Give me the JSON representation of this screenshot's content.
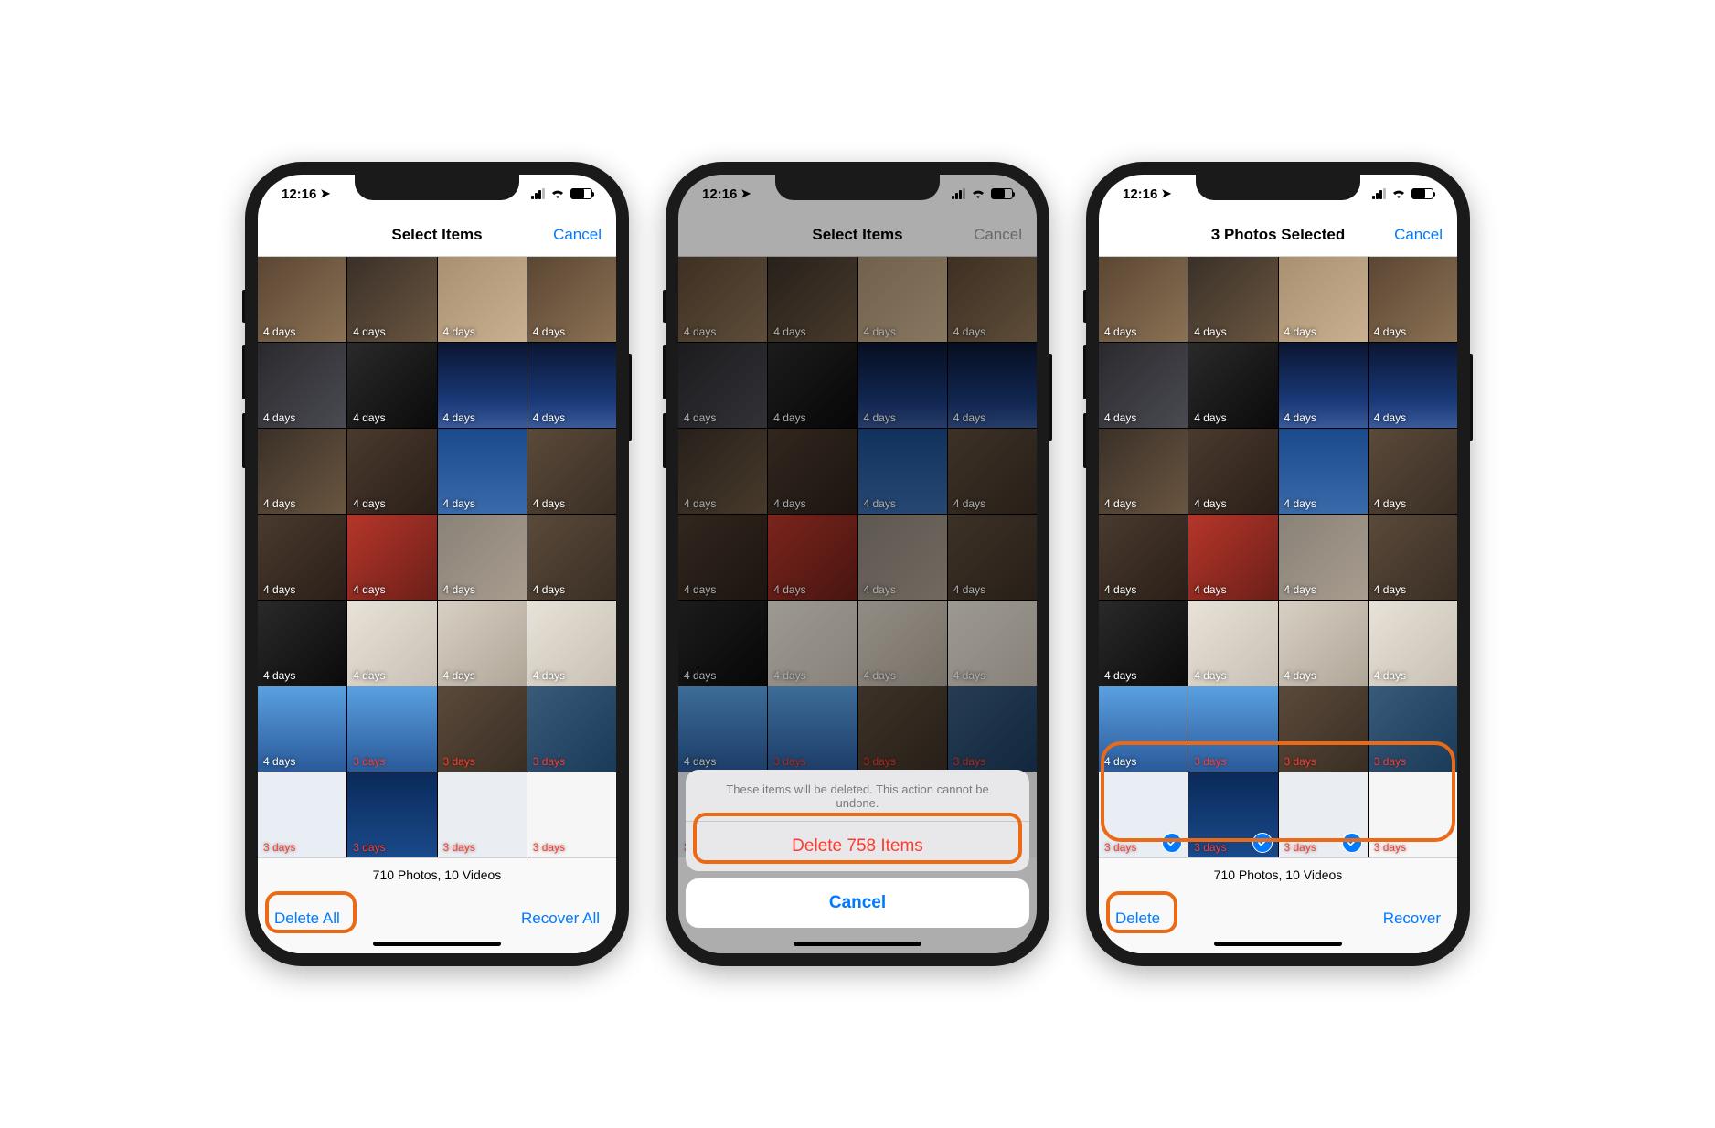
{
  "status": {
    "time": "12:16",
    "nav_glyph": "➤"
  },
  "nav": {
    "title_select": "Select Items",
    "title_selected": "3 Photos Selected",
    "cancel": "Cancel"
  },
  "labels": {
    "d4": "4 days",
    "d3": "3 days"
  },
  "toolbar": {
    "counts": "710 Photos, 10 Videos",
    "delete_all": "Delete All",
    "recover_all": "Recover All",
    "delete": "Delete",
    "recover": "Recover"
  },
  "sheet": {
    "message": "These items will be deleted. This action cannot be undone.",
    "delete_items": "Delete 758 Items",
    "cancel": "Cancel"
  },
  "grid": {
    "rows": [
      [
        {
          "bg": "bg-a",
          "lbl": "d4"
        },
        {
          "bg": "bg-d",
          "lbl": "d4"
        },
        {
          "bg": "bg-e",
          "lbl": "d4"
        },
        {
          "bg": "bg-a",
          "lbl": "d4"
        }
      ],
      [
        {
          "bg": "bg-b",
          "lbl": "d4"
        },
        {
          "bg": "bg-i",
          "lbl": "d4"
        },
        {
          "bg": "bg-c",
          "lbl": "d4"
        },
        {
          "bg": "bg-c",
          "lbl": "d4"
        }
      ],
      [
        {
          "bg": "bg-d",
          "lbl": "d4"
        },
        {
          "bg": "bg-f",
          "lbl": "d4"
        },
        {
          "bg": "bg-k",
          "lbl": "d4"
        },
        {
          "bg": "bg-p",
          "lbl": "d4"
        }
      ],
      [
        {
          "bg": "bg-f",
          "lbl": "d4"
        },
        {
          "bg": "bg-g",
          "lbl": "d4"
        },
        {
          "bg": "bg-h",
          "lbl": "d4"
        },
        {
          "bg": "bg-p",
          "lbl": "d4"
        }
      ],
      [
        {
          "bg": "bg-i",
          "lbl": "d4"
        },
        {
          "bg": "bg-j",
          "lbl": "d4"
        },
        {
          "bg": "bg-l",
          "lbl": "d4"
        },
        {
          "bg": "bg-j",
          "lbl": "d4"
        }
      ],
      [
        {
          "bg": "bg-m",
          "lbl": "d4"
        },
        {
          "bg": "bg-m",
          "lbl": "d3",
          "red": true
        },
        {
          "bg": "bg-p",
          "lbl": "d3",
          "red": true
        },
        {
          "bg": "bg-n",
          "lbl": "d3",
          "red": true
        }
      ],
      [
        {
          "bg": "bg-doc1",
          "lbl": "d3",
          "red": true
        },
        {
          "bg": "bg-doc2",
          "lbl": "d3",
          "red": true
        },
        {
          "bg": "bg-doc3",
          "lbl": "d3",
          "red": true
        },
        {
          "bg": "bg-doc4",
          "lbl": "d3",
          "red": true
        }
      ]
    ]
  },
  "phone3_selected_row": 6,
  "phone3_selected_cols": [
    0,
    1,
    2
  ]
}
